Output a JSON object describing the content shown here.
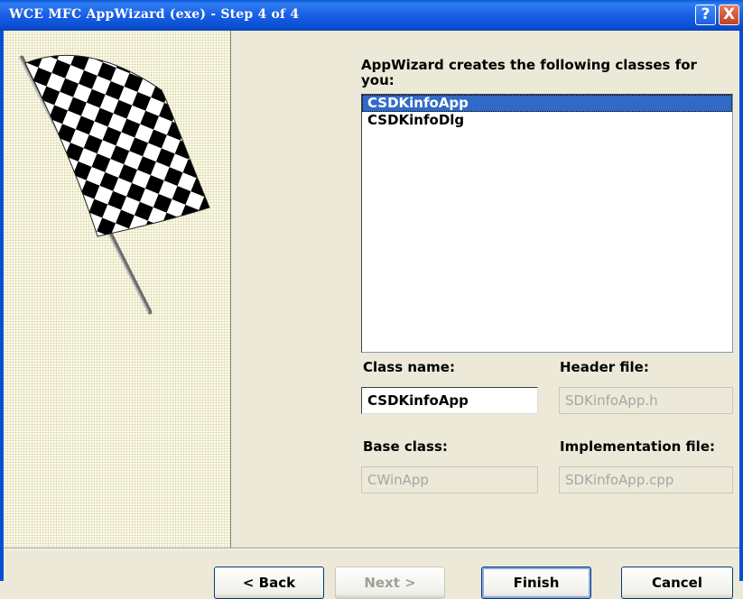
{
  "window": {
    "title": "WCE MFC AppWizard (exe) - Step 4 of 4",
    "help_glyph": "?",
    "close_glyph": "X"
  },
  "classes": {
    "heading_line1": "AppWizard creates the following classes for",
    "heading_line2": "you:",
    "items": [
      "CSDKinfoApp",
      "CSDKinfoDlg"
    ],
    "selected": "CSDKinfoApp"
  },
  "fields": {
    "class_name_label": "Class name:",
    "class_name_value": "CSDKinfoApp",
    "header_file_label": "Header file:",
    "header_file_value": "SDKinfoApp.h",
    "base_class_label": "Base class:",
    "base_class_value": "CWinApp",
    "impl_file_label": "Implementation file:",
    "impl_file_value": "SDKinfoApp.cpp"
  },
  "buttons": {
    "back": "< Back",
    "next": "Next >",
    "finish": "Finish",
    "cancel": "Cancel"
  },
  "colors": {
    "titlebar": "#0a4fd3",
    "selection": "#316ac5",
    "dialog_bg": "#ece9d8"
  },
  "icons": [
    "help-icon",
    "close-icon",
    "checkered-flag-icon"
  ]
}
